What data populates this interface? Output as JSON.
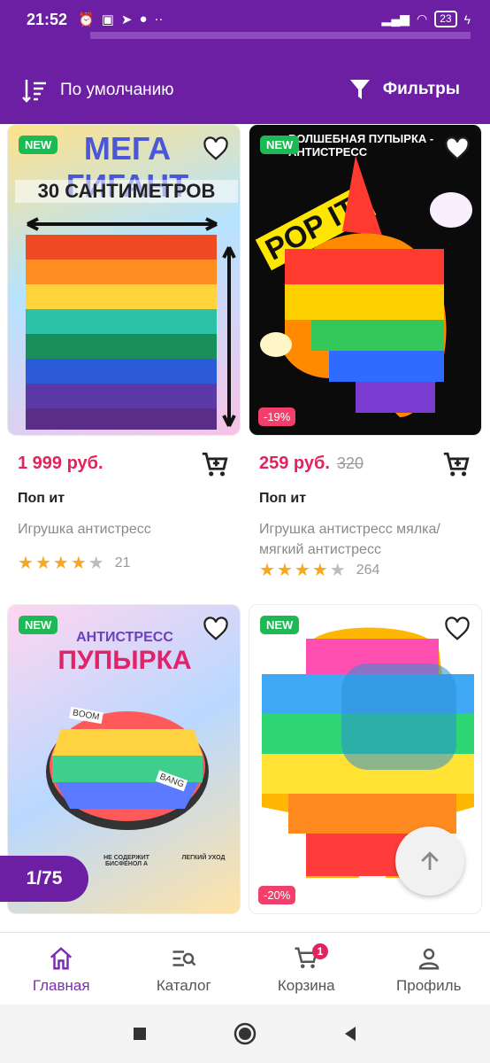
{
  "status_bar": {
    "time": "21:52",
    "battery": "23"
  },
  "toolbar": {
    "sort_label": "По умолчанию",
    "filter_label": "Фильтры"
  },
  "products": [
    {
      "badge": "NEW",
      "price": "1 999 руб.",
      "old_price": "",
      "discount": "",
      "name": "Поп ит",
      "description": "Игрушка антистресс",
      "rating": 4,
      "reviews": "21",
      "image_text": [
        "МЕГА ГИГАНТ",
        "30 САНТИМЕТРОВ"
      ]
    },
    {
      "badge": "NEW",
      "price": "259 руб.",
      "old_price": "320",
      "discount": "-19%",
      "name": "Поп ит",
      "description": "Игрушка антистресс мялка/ мягкий антистресс",
      "rating": 4,
      "reviews": "264",
      "image_text": [
        "ВОЛШЕБНАЯ ПУПЫРКА - АНТИСТРЕСС",
        "POP IT!"
      ]
    },
    {
      "badge": "NEW",
      "price": "",
      "old_price": "",
      "discount": "",
      "name": "",
      "description": "",
      "rating": 0,
      "reviews": "",
      "image_text": [
        "АНТИСТРЕСС",
        "ПУПЫРКА",
        "BOOM",
        "BANG",
        "НЕ СОДЕРЖИТ БИСФЕНОЛ А",
        "ЛЕГКИЙ УХОД"
      ]
    },
    {
      "badge": "NEW",
      "price": "",
      "old_price": "",
      "discount": "-20%",
      "name": "",
      "description": "",
      "rating": 0,
      "reviews": "",
      "image_text": []
    }
  ],
  "pagination": {
    "label": "1/75"
  },
  "bottom_nav": {
    "items": [
      {
        "label": "Главная",
        "icon": "home-icon",
        "active": true
      },
      {
        "label": "Каталог",
        "icon": "catalog-search-icon",
        "active": false
      },
      {
        "label": "Корзина",
        "icon": "cart-icon",
        "active": false,
        "badge": "1"
      },
      {
        "label": "Профиль",
        "icon": "profile-icon",
        "active": false
      }
    ]
  },
  "colors": {
    "brand": "#6c1fa3",
    "price": "#e0245e",
    "new_badge": "#1db954",
    "star": "#f7a823"
  }
}
